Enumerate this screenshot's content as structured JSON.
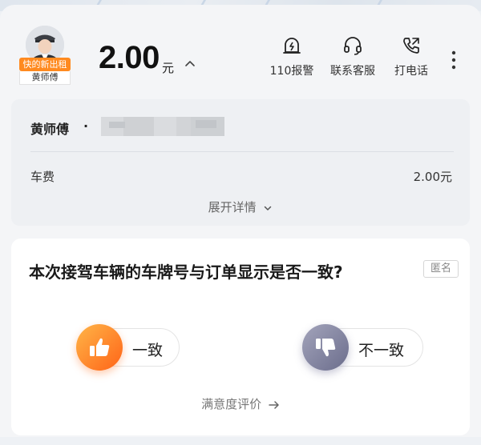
{
  "driver": {
    "badge": "快的新出租",
    "name_tag": "黄师傅",
    "name": "黄师傅",
    "separator": "·"
  },
  "fare": {
    "amount": "2.00",
    "unit": "元"
  },
  "actions": [
    {
      "label": "110报警",
      "icon": "alarm-icon"
    },
    {
      "label": "联系客服",
      "icon": "headset-icon"
    },
    {
      "label": "打电话",
      "icon": "phone-icon"
    }
  ],
  "details": {
    "fee_label": "车费",
    "fee_value": "2.00元",
    "expand_label": "展开详情"
  },
  "question": {
    "text": "本次接驾车辆的车牌号与订单显示是否一致?",
    "anonymous_tag": "匿名",
    "yes_label": "一致",
    "no_label": "不一致",
    "satisfaction_link": "满意度评价"
  },
  "colors": {
    "yes_gradient": [
      "#ffae3c",
      "#ff6a1a"
    ],
    "no_gradient": [
      "#9a9bb3",
      "#6e7090"
    ],
    "badge": "#ff8a1f"
  }
}
